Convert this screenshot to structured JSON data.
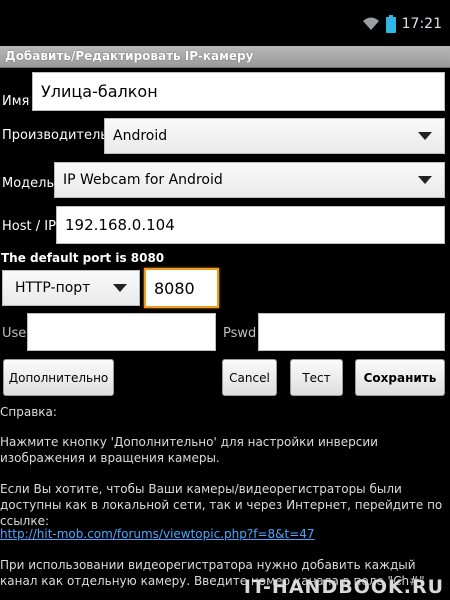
{
  "status_bar": {
    "time": "17:21",
    "icons": [
      "wifi-icon",
      "battery-icon"
    ]
  },
  "title": "Добавить/Редактировать IP-камеру",
  "form": {
    "name_label": "Имя",
    "name_value": "Улица-балкон",
    "maker_label": "Производитель",
    "maker_value": "Android",
    "model_label": "Модель",
    "model_value": "IP Webcam for Android",
    "host_label": "Host / IP",
    "host_value": "192.168.0.104",
    "port_note": "The default port is 8080",
    "protocol_value": "HTTP-порт",
    "port_value": "8080",
    "user_label": "User",
    "user_value": "",
    "pswd_label": "Pswd",
    "pswd_value": ""
  },
  "buttons": {
    "advanced": "Дополнительно",
    "cancel": "Cancel",
    "test": "Тест",
    "save": "Сохранить"
  },
  "help": {
    "heading": "Справка:",
    "p1": "Нажмите кнопку 'Дополнительно' для настройки инверсии изображения и вращения камеры.",
    "p2": "Если Вы хотите, чтобы Ваши камеры/видеорегистраторы были доступны как в локальной сети, так и через Интернет, перейдите по ссылке:",
    "link": "http://hit-mob.com/forums/viewtopic.php?f=8&t=47",
    "p3": "При использовании видеорегистратора нужно добавить каждый канал как отдельную камеру. Введите номер канала в поле \"Ch#\""
  },
  "watermark": "IT-HANDBOOK.RU",
  "colors": {
    "focus": "#f39a1f",
    "link": "#4da6ff",
    "title_bar": "#a9a9a9"
  }
}
